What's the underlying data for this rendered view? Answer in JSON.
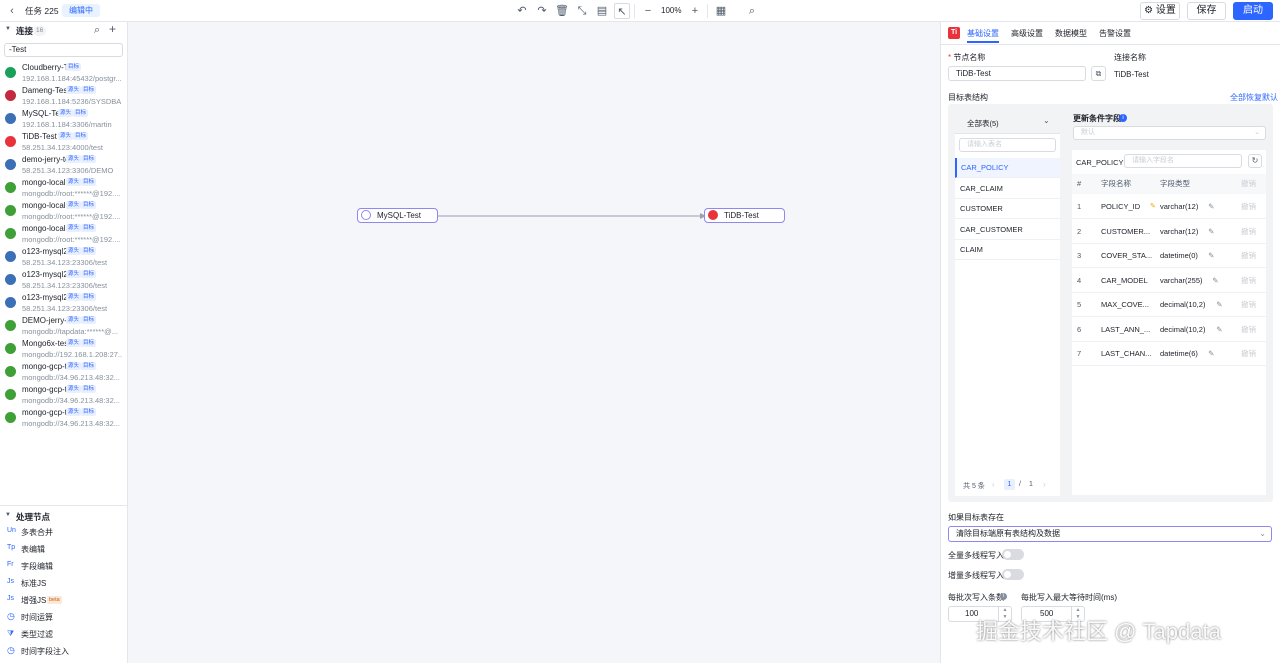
{
  "topbar": {
    "task_name": "任务 225",
    "status": "编辑中",
    "zoom": "100%",
    "settings_label": "设置",
    "save_label": "保存",
    "start_label": "启动"
  },
  "left": {
    "connections_title": "连接",
    "connections_count": "16",
    "search_value": "-Test",
    "connections": [
      {
        "name": "Cloudberry-Test",
        "addr": "192.168.1.184:45432/postgr...",
        "tags": [
          "目标"
        ],
        "icon_color": "#19a05a"
      },
      {
        "name": "Dameng-Test",
        "addr": "192.168.1.184:5236/SYSDBA...",
        "tags": [
          "源头",
          "目标"
        ],
        "icon_color": "#c22b3d"
      },
      {
        "name": "MySQL-Test",
        "addr": "192.168.1.184:3306/martin",
        "tags": [
          "源头",
          "目标"
        ],
        "icon_color": "#3b6fb6"
      },
      {
        "name": "TiDB-Test",
        "addr": "58.251.34.123:4000/test",
        "tags": [
          "源头",
          "目标"
        ],
        "icon_color": "#e8333b"
      },
      {
        "name": "demo-jerry-test",
        "addr": "58.251.34.123:3306/DEMO",
        "tags": [
          "源头",
          "目标"
        ],
        "icon_color": "#3b6fb6"
      },
      {
        "name": "mongo-local-tes...",
        "addr": "mongodb://root:******@192....",
        "tags": [
          "源头",
          "目标"
        ],
        "icon_color": "#3fa037"
      },
      {
        "name": "mongo-local-tes...",
        "addr": "mongodb://root:******@192....",
        "tags": [
          "源头",
          "目标"
        ],
        "icon_color": "#3fa037"
      },
      {
        "name": "mongo-local-tes...",
        "addr": "mongodb://root:******@192....",
        "tags": [
          "源头",
          "目标"
        ],
        "icon_color": "#3fa037"
      },
      {
        "name": "o123-mysql2330...",
        "addr": "58.251.34.123:23306/test",
        "tags": [
          "源头",
          "目标"
        ],
        "icon_color": "#3b6fb6"
      },
      {
        "name": "o123-mysql2330...",
        "addr": "58.251.34.123:23306/test",
        "tags": [
          "源头",
          "目标"
        ],
        "icon_color": "#3b6fb6"
      },
      {
        "name": "o123-mysql2330...",
        "addr": "58.251.34.123:23306/test",
        "tags": [
          "源头",
          "目标"
        ],
        "icon_color": "#3b6fb6"
      },
      {
        "name": "DEMO-jerry-test",
        "addr": "mongodb://tapdata:******@...",
        "tags": [
          "源头",
          "目标"
        ],
        "icon_color": "#3fa037"
      },
      {
        "name": "Mongo6x-test-u...",
        "addr": "mongodb://192.168.1.208:27...",
        "tags": [
          "源头",
          "目标"
        ],
        "icon_color": "#3fa037"
      },
      {
        "name": "mongo-gcp-test...",
        "addr": "mongodb://34.96.213.48:32...",
        "tags": [
          "源头",
          "目标"
        ],
        "icon_color": "#3fa037"
      },
      {
        "name": "mongo-gcp-test...",
        "addr": "mongodb://34.96.213.48:32...",
        "tags": [
          "源头",
          "目标"
        ],
        "icon_color": "#3fa037"
      },
      {
        "name": "mongo-gcp-test...",
        "addr": "mongodb://34.96.213.48:32...",
        "tags": [
          "源头",
          "目标"
        ],
        "icon_color": "#3fa037"
      }
    ],
    "process_title": "处理节点",
    "process_nodes": [
      {
        "icon": "Un",
        "label": "多表合并"
      },
      {
        "icon": "Tp",
        "label": "表编辑"
      },
      {
        "icon": "Fr",
        "label": "字段编辑"
      },
      {
        "icon": "Js",
        "label": "标准JS"
      },
      {
        "icon": "Js",
        "label": "增强JS",
        "badge": "beta"
      },
      {
        "icon": "clock",
        "label": "时间运算"
      },
      {
        "icon": "filter",
        "label": "类型过滤"
      },
      {
        "icon": "clock",
        "label": "时间字段注入"
      }
    ]
  },
  "canvas": {
    "source_node": "MySQL-Test",
    "target_node": "TiDB-Test"
  },
  "right": {
    "tabs": [
      "基础设置",
      "高级设置",
      "数据模型",
      "告警设置"
    ],
    "node_name_label": "节点名称",
    "node_name_value": "TiDB-Test",
    "conn_name_label": "连接名称",
    "conn_name_value": "TiDB-Test",
    "target_struct_label": "目标表结构",
    "restore_all": "全部恢复默认",
    "all_tables": "全部表(5)",
    "table_search_ph": "请输入表名",
    "update_field_label": "更新条件字段",
    "update_field_ph": "默认",
    "tables": [
      "CAR_POLICY",
      "CAR_CLAIM",
      "CUSTOMER",
      "CAR_CUSTOMER",
      "CLAIM"
    ],
    "current_table": "CAR_POLICY",
    "field_search_ph": "请输入字段名",
    "field_headers": {
      "num": "#",
      "name": "字段名称",
      "type": "字段类型",
      "undo": "撤销"
    },
    "fields": [
      {
        "num": "1",
        "name": "POLICY_ID",
        "type": "varchar(12)",
        "undo": "撤销",
        "key": true
      },
      {
        "num": "2",
        "name": "CUSTOMER...",
        "type": "varchar(12)",
        "undo": "撤销"
      },
      {
        "num": "3",
        "name": "COVER_STA...",
        "type": "datetime(0)",
        "undo": "撤销"
      },
      {
        "num": "4",
        "name": "CAR_MODEL",
        "type": "varchar(255)",
        "undo": "撤销"
      },
      {
        "num": "5",
        "name": "MAX_COVE...",
        "type": "decimal(10,2)",
        "undo": "撤销"
      },
      {
        "num": "6",
        "name": "LAST_ANN_...",
        "type": "decimal(10,2)",
        "undo": "撤销"
      },
      {
        "num": "7",
        "name": "LAST_CHAN...",
        "type": "datetime(6)",
        "undo": "撤销"
      }
    ],
    "pagination": {
      "total": "共 5 条",
      "page": "1",
      "sep": "/",
      "pages": "1"
    },
    "exist_label": "如果目标表存在",
    "exist_value": "清除目标端原有表结构及数据",
    "full_multi_label": "全量多线程写入",
    "inc_multi_label": "增量多线程写入",
    "batch_label": "每批次写入条数",
    "batch_value": "100",
    "wait_label": "每批写入最大等待时间(ms)",
    "wait_value": "500"
  },
  "watermark": "掘金技术社区 @ Tapdata"
}
